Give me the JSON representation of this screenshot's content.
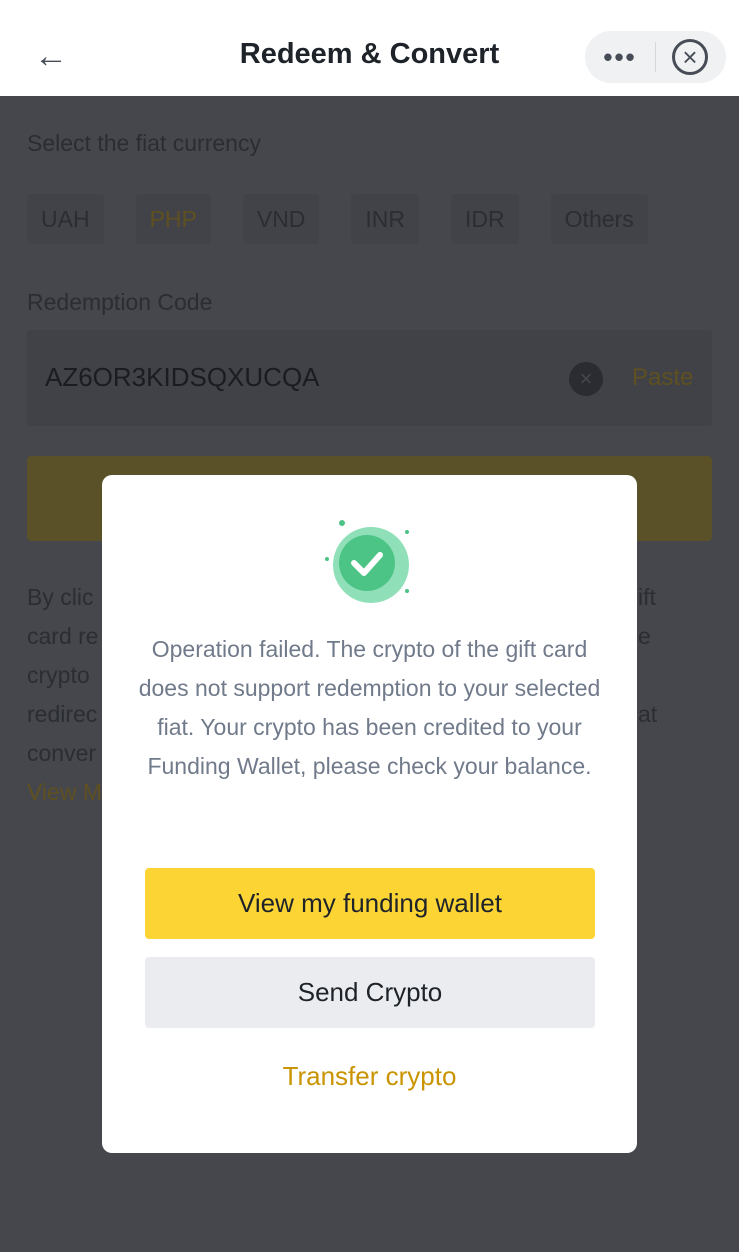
{
  "header": {
    "title": "Redeem & Convert",
    "back_icon": "arrow-left-icon",
    "more_icon": "more-dots-icon",
    "close_icon": "close-circle-icon"
  },
  "form": {
    "fiat_label": "Select the fiat currency",
    "currencies": [
      {
        "label": "UAH"
      },
      {
        "label": "PHP",
        "active": true
      },
      {
        "label": "VND"
      },
      {
        "label": "INR"
      },
      {
        "label": "IDR"
      },
      {
        "label": "Others"
      }
    ],
    "code_label": "Redemption Code",
    "code_value": "AZ6OR3KIDSQXUCQA",
    "paste_label": "Paste",
    "disclaimer_fragments_left": [
      "By clic",
      "card re",
      "crypto",
      "redirec",
      "conver"
    ],
    "disclaimer_fragments_right": [
      "ift",
      "e",
      "at"
    ],
    "view_more_fragment": "View M"
  },
  "modal": {
    "icon": "success-check-icon",
    "message": "Operation failed. The crypto of the gift card does not support redemption to your selected fiat. Your crypto has been credited to your Funding Wallet, please check your balance.",
    "primary_button": "View my funding wallet",
    "secondary_button": "Send Crypto",
    "link": "Transfer crypto"
  },
  "colors": {
    "accent": "#FCD535",
    "link": "#C99400",
    "success": "#2EBD85"
  }
}
